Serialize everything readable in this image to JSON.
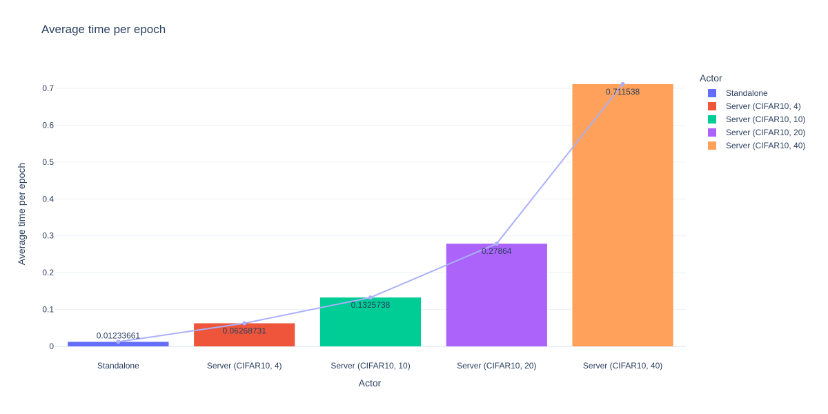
{
  "chart_data": {
    "type": "bar",
    "title": "Average time per epoch",
    "xlabel": "Actor",
    "ylabel": "Average time per epoch",
    "ylim": [
      0,
      0.745
    ],
    "yticks": [
      0,
      0.1,
      0.2,
      0.3,
      0.4,
      0.5,
      0.6,
      0.7
    ],
    "ytick_labels": [
      "0",
      "0.1",
      "0.2",
      "0.3",
      "0.4",
      "0.5",
      "0.6",
      "0.7"
    ],
    "grid": true,
    "categories": [
      "Standalone",
      "Server (CIFAR10, 4)",
      "Server (CIFAR10, 10)",
      "Server (CIFAR10, 20)",
      "Server (CIFAR10, 40)"
    ],
    "values": [
      0.01233661,
      0.06268731,
      0.1325738,
      0.27864,
      0.711538
    ],
    "value_labels": [
      "0.01233661",
      "0.06268731",
      "0.1325738",
      "0.27864",
      "0.711538"
    ],
    "colors": [
      "#636efa",
      "#EF553B",
      "#00cc96",
      "#ab63fa",
      "#FFA15A"
    ],
    "line_overlay": {
      "type": "line",
      "color": "#aab0fb",
      "values": [
        0.01233661,
        0.06268731,
        0.1325738,
        0.27864,
        0.711538
      ]
    },
    "legend": {
      "title": "Actor",
      "placement": "right",
      "entries": [
        "Standalone",
        "Server (CIFAR10, 4)",
        "Server (CIFAR10, 10)",
        "Server (CIFAR10, 20)",
        "Server (CIFAR10, 40)"
      ]
    }
  }
}
